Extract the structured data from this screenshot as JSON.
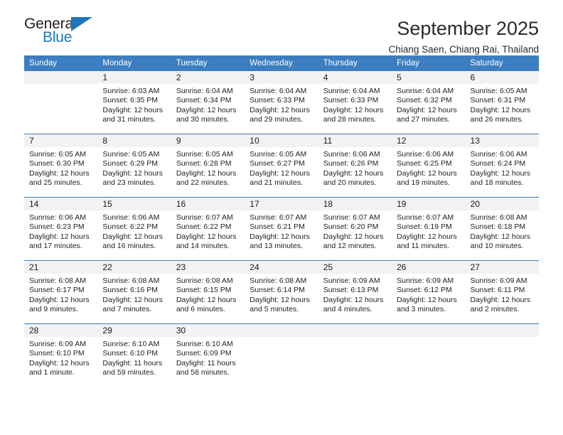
{
  "logo": {
    "word_general": "General",
    "word_blue": "Blue",
    "triangle_color": "#1c76bc"
  },
  "header": {
    "title": "September 2025",
    "subtitle": "Chiang Saen, Chiang Rai, Thailand"
  },
  "colors": {
    "header_blue": "#3c7ebf",
    "daynum_band": "#f2f2f2",
    "text": "#222222"
  },
  "calendar": {
    "weekday_headers": [
      "Sunday",
      "Monday",
      "Tuesday",
      "Wednesday",
      "Thursday",
      "Friday",
      "Saturday"
    ],
    "weeks": [
      [
        {
          "day": "",
          "blank": true,
          "sunrise": "",
          "sunset": "",
          "daylight1": "",
          "daylight2": ""
        },
        {
          "day": "1",
          "sunrise": "Sunrise: 6:03 AM",
          "sunset": "Sunset: 6:35 PM",
          "daylight1": "Daylight: 12 hours",
          "daylight2": "and 31 minutes."
        },
        {
          "day": "2",
          "sunrise": "Sunrise: 6:04 AM",
          "sunset": "Sunset: 6:34 PM",
          "daylight1": "Daylight: 12 hours",
          "daylight2": "and 30 minutes."
        },
        {
          "day": "3",
          "sunrise": "Sunrise: 6:04 AM",
          "sunset": "Sunset: 6:33 PM",
          "daylight1": "Daylight: 12 hours",
          "daylight2": "and 29 minutes."
        },
        {
          "day": "4",
          "sunrise": "Sunrise: 6:04 AM",
          "sunset": "Sunset: 6:33 PM",
          "daylight1": "Daylight: 12 hours",
          "daylight2": "and 28 minutes."
        },
        {
          "day": "5",
          "sunrise": "Sunrise: 6:04 AM",
          "sunset": "Sunset: 6:32 PM",
          "daylight1": "Daylight: 12 hours",
          "daylight2": "and 27 minutes."
        },
        {
          "day": "6",
          "sunrise": "Sunrise: 6:05 AM",
          "sunset": "Sunset: 6:31 PM",
          "daylight1": "Daylight: 12 hours",
          "daylight2": "and 26 minutes."
        }
      ],
      [
        {
          "day": "7",
          "sunrise": "Sunrise: 6:05 AM",
          "sunset": "Sunset: 6:30 PM",
          "daylight1": "Daylight: 12 hours",
          "daylight2": "and 25 minutes."
        },
        {
          "day": "8",
          "sunrise": "Sunrise: 6:05 AM",
          "sunset": "Sunset: 6:29 PM",
          "daylight1": "Daylight: 12 hours",
          "daylight2": "and 23 minutes."
        },
        {
          "day": "9",
          "sunrise": "Sunrise: 6:05 AM",
          "sunset": "Sunset: 6:28 PM",
          "daylight1": "Daylight: 12 hours",
          "daylight2": "and 22 minutes."
        },
        {
          "day": "10",
          "sunrise": "Sunrise: 6:05 AM",
          "sunset": "Sunset: 6:27 PM",
          "daylight1": "Daylight: 12 hours",
          "daylight2": "and 21 minutes."
        },
        {
          "day": "11",
          "sunrise": "Sunrise: 6:06 AM",
          "sunset": "Sunset: 6:26 PM",
          "daylight1": "Daylight: 12 hours",
          "daylight2": "and 20 minutes."
        },
        {
          "day": "12",
          "sunrise": "Sunrise: 6:06 AM",
          "sunset": "Sunset: 6:25 PM",
          "daylight1": "Daylight: 12 hours",
          "daylight2": "and 19 minutes."
        },
        {
          "day": "13",
          "sunrise": "Sunrise: 6:06 AM",
          "sunset": "Sunset: 6:24 PM",
          "daylight1": "Daylight: 12 hours",
          "daylight2": "and 18 minutes."
        }
      ],
      [
        {
          "day": "14",
          "sunrise": "Sunrise: 6:06 AM",
          "sunset": "Sunset: 6:23 PM",
          "daylight1": "Daylight: 12 hours",
          "daylight2": "and 17 minutes."
        },
        {
          "day": "15",
          "sunrise": "Sunrise: 6:06 AM",
          "sunset": "Sunset: 6:22 PM",
          "daylight1": "Daylight: 12 hours",
          "daylight2": "and 16 minutes."
        },
        {
          "day": "16",
          "sunrise": "Sunrise: 6:07 AM",
          "sunset": "Sunset: 6:22 PM",
          "daylight1": "Daylight: 12 hours",
          "daylight2": "and 14 minutes."
        },
        {
          "day": "17",
          "sunrise": "Sunrise: 6:07 AM",
          "sunset": "Sunset: 6:21 PM",
          "daylight1": "Daylight: 12 hours",
          "daylight2": "and 13 minutes."
        },
        {
          "day": "18",
          "sunrise": "Sunrise: 6:07 AM",
          "sunset": "Sunset: 6:20 PM",
          "daylight1": "Daylight: 12 hours",
          "daylight2": "and 12 minutes."
        },
        {
          "day": "19",
          "sunrise": "Sunrise: 6:07 AM",
          "sunset": "Sunset: 6:19 PM",
          "daylight1": "Daylight: 12 hours",
          "daylight2": "and 11 minutes."
        },
        {
          "day": "20",
          "sunrise": "Sunrise: 6:08 AM",
          "sunset": "Sunset: 6:18 PM",
          "daylight1": "Daylight: 12 hours",
          "daylight2": "and 10 minutes."
        }
      ],
      [
        {
          "day": "21",
          "sunrise": "Sunrise: 6:08 AM",
          "sunset": "Sunset: 6:17 PM",
          "daylight1": "Daylight: 12 hours",
          "daylight2": "and 9 minutes."
        },
        {
          "day": "22",
          "sunrise": "Sunrise: 6:08 AM",
          "sunset": "Sunset: 6:16 PM",
          "daylight1": "Daylight: 12 hours",
          "daylight2": "and 7 minutes."
        },
        {
          "day": "23",
          "sunrise": "Sunrise: 6:08 AM",
          "sunset": "Sunset: 6:15 PM",
          "daylight1": "Daylight: 12 hours",
          "daylight2": "and 6 minutes."
        },
        {
          "day": "24",
          "sunrise": "Sunrise: 6:08 AM",
          "sunset": "Sunset: 6:14 PM",
          "daylight1": "Daylight: 12 hours",
          "daylight2": "and 5 minutes."
        },
        {
          "day": "25",
          "sunrise": "Sunrise: 6:09 AM",
          "sunset": "Sunset: 6:13 PM",
          "daylight1": "Daylight: 12 hours",
          "daylight2": "and 4 minutes."
        },
        {
          "day": "26",
          "sunrise": "Sunrise: 6:09 AM",
          "sunset": "Sunset: 6:12 PM",
          "daylight1": "Daylight: 12 hours",
          "daylight2": "and 3 minutes."
        },
        {
          "day": "27",
          "sunrise": "Sunrise: 6:09 AM",
          "sunset": "Sunset: 6:11 PM",
          "daylight1": "Daylight: 12 hours",
          "daylight2": "and 2 minutes."
        }
      ],
      [
        {
          "day": "28",
          "sunrise": "Sunrise: 6:09 AM",
          "sunset": "Sunset: 6:10 PM",
          "daylight1": "Daylight: 12 hours",
          "daylight2": "and 1 minute."
        },
        {
          "day": "29",
          "sunrise": "Sunrise: 6:10 AM",
          "sunset": "Sunset: 6:10 PM",
          "daylight1": "Daylight: 11 hours",
          "daylight2": "and 59 minutes."
        },
        {
          "day": "30",
          "sunrise": "Sunrise: 6:10 AM",
          "sunset": "Sunset: 6:09 PM",
          "daylight1": "Daylight: 11 hours",
          "daylight2": "and 58 minutes."
        },
        {
          "day": "",
          "blank": true,
          "sunrise": "",
          "sunset": "",
          "daylight1": "",
          "daylight2": ""
        },
        {
          "day": "",
          "blank": true,
          "sunrise": "",
          "sunset": "",
          "daylight1": "",
          "daylight2": ""
        },
        {
          "day": "",
          "blank": true,
          "sunrise": "",
          "sunset": "",
          "daylight1": "",
          "daylight2": ""
        },
        {
          "day": "",
          "blank": true,
          "sunrise": "",
          "sunset": "",
          "daylight1": "",
          "daylight2": ""
        }
      ]
    ]
  }
}
